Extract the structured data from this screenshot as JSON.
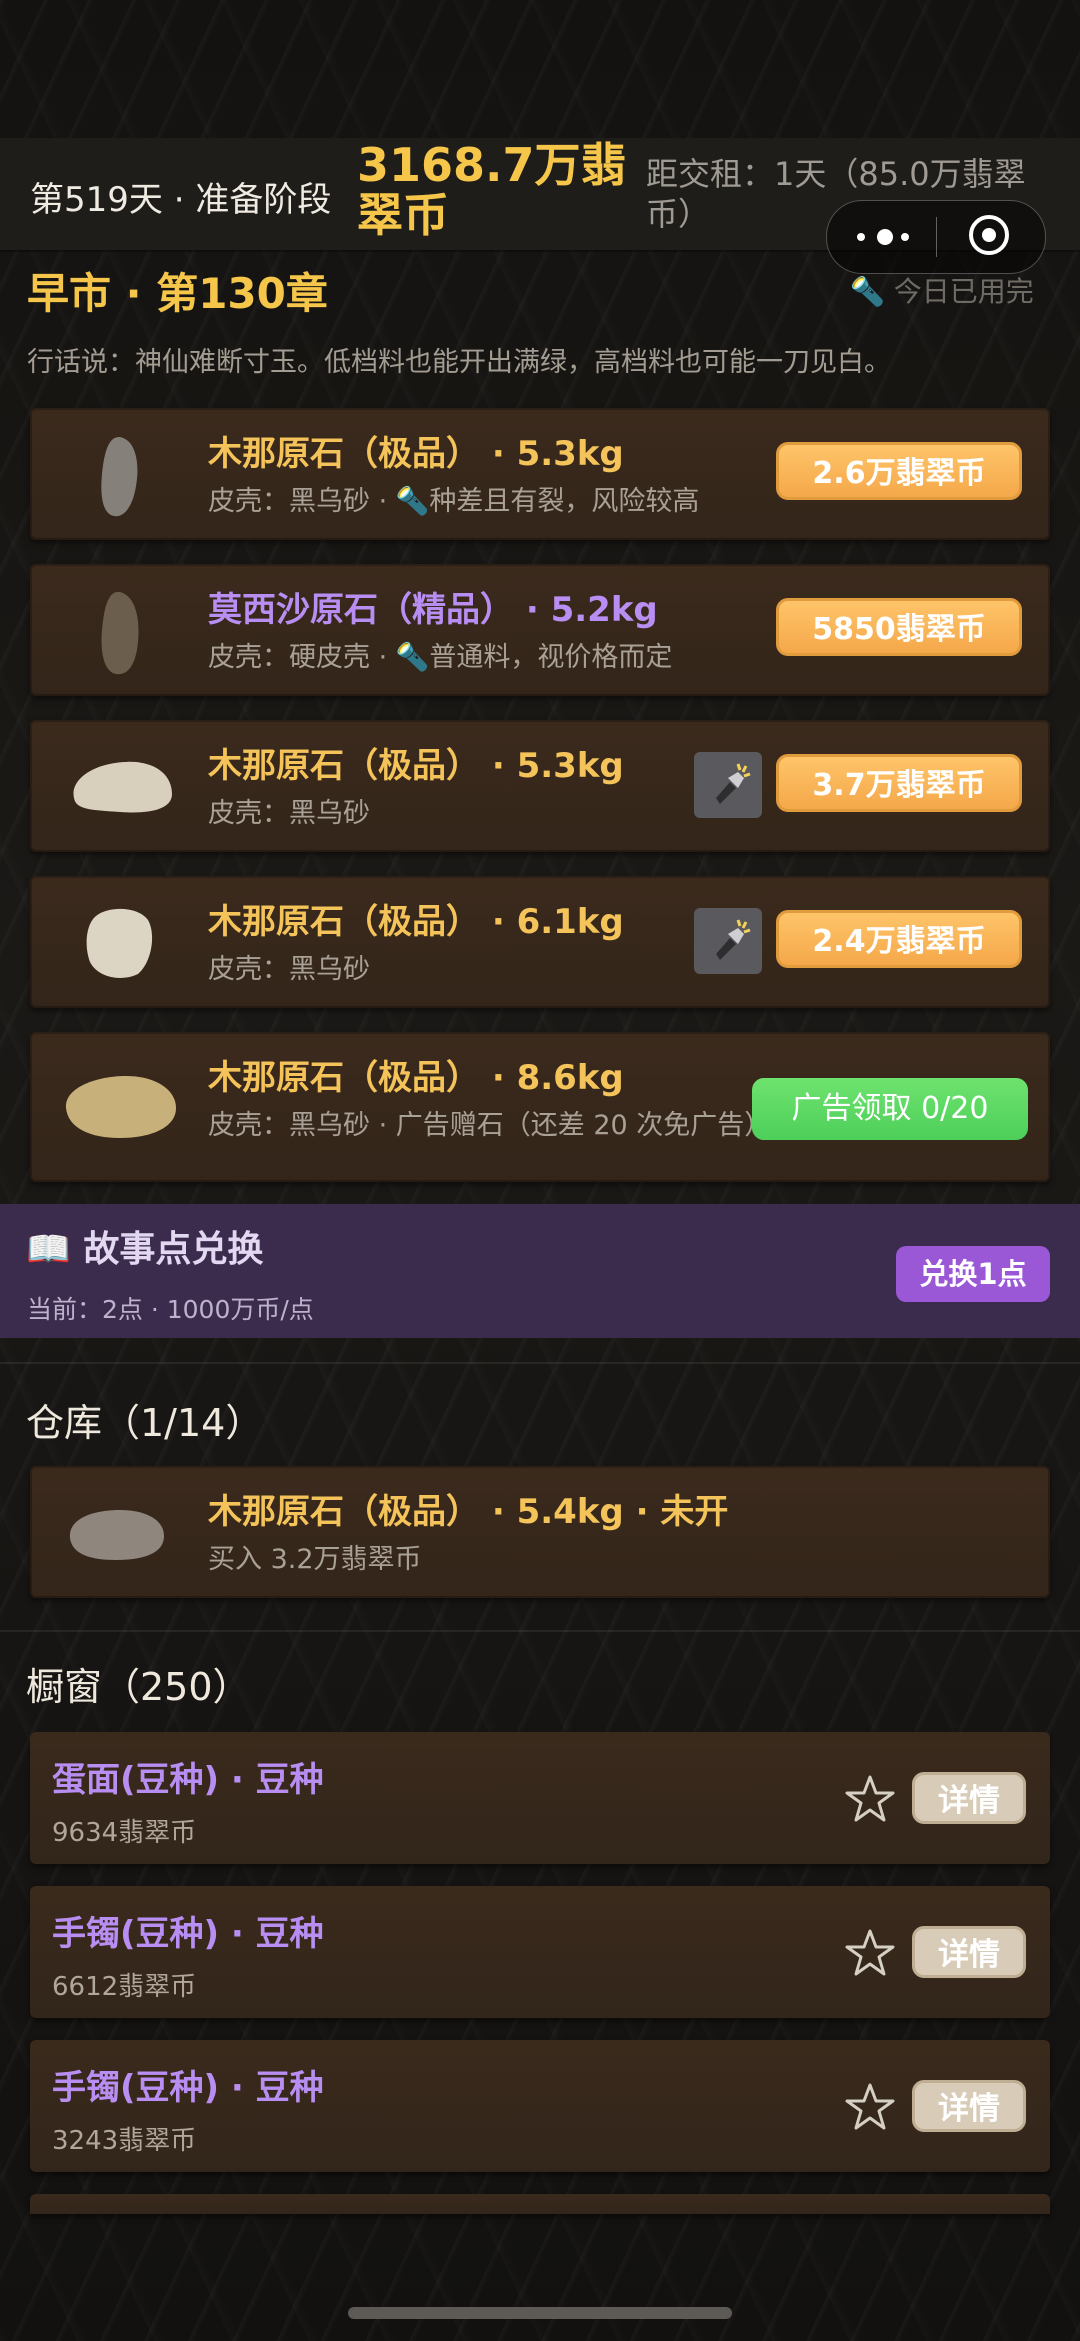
{
  "status": {
    "day": "第519天 · 准备阶段",
    "money": "3168.7万翡翠币",
    "rent": "距交租：1天（85.0万翡翠币）"
  },
  "header": {
    "chapter": "早市 · 第130章",
    "used_today": "🔦 今日已用完",
    "saying": "行话说：神仙难断寸玉。低档料也能开出满绿，高档料也可能一刀见白。"
  },
  "market_items": [
    {
      "title": "木那原石（极品） · 5.3kg",
      "sub": "皮壳：黑乌砂 · 🔦种差且有裂，风险较高",
      "price": "2.6万翡翠币",
      "title_color": "gold",
      "stone_color": "#858079"
    },
    {
      "title": "莫西沙原石（精品） · 5.2kg",
      "sub": "皮壳：硬皮壳 · 🔦普通料，视价格而定",
      "price": "5850翡翠币",
      "title_color": "purple",
      "stone_color": "#6c5e4c"
    },
    {
      "title": "木那原石（极品） · 5.3kg",
      "sub": "皮壳：黑乌砂",
      "price": "3.7万翡翠币",
      "title_color": "gold",
      "stone_color": "#d8cfbd"
    },
    {
      "title": "木那原石（极品） · 6.1kg",
      "sub": "皮壳：黑乌砂",
      "price": "2.4万翡翠币",
      "title_color": "gold",
      "stone_color": "#ddd5c3"
    },
    {
      "title": "木那原石（极品） · 8.6kg",
      "sub": "皮壳：黑乌砂 · 广告赠石（还差 20 次免广告）",
      "ad": "广告领取 0/20",
      "title_color": "gold",
      "stone_color": "#c8b07a"
    }
  ],
  "story": {
    "title": "📖 故事点兑换",
    "sub": "当前：2点 · 1000万币/点",
    "button": "兑换1点"
  },
  "warehouse": {
    "title": "仓库（1/14）",
    "item_title": "木那原石（极品） · 5.4kg · 未开",
    "item_sub": "买入 3.2万翡翠币"
  },
  "showcase": {
    "title": "橱窗（250）",
    "detail_label": "详情",
    "items": [
      {
        "title": "蛋面(豆种) · 豆种",
        "price": "9634翡翠币"
      },
      {
        "title": "手镯(豆种) · 豆种",
        "price": "6612翡翠币"
      },
      {
        "title": "手镯(豆种) · 豆种",
        "price": "3243翡翠币"
      }
    ]
  },
  "icons": [
    "more-dots-icon",
    "target-icon",
    "flashlight-icon",
    "book-icon",
    "star-icon"
  ],
  "colors": {
    "gold": "#f6c64a",
    "purple": "#b98ef2",
    "orange_button": "#f4a84a",
    "green_button": "#4dcf5a",
    "story_bg": "#3b2b4d"
  }
}
